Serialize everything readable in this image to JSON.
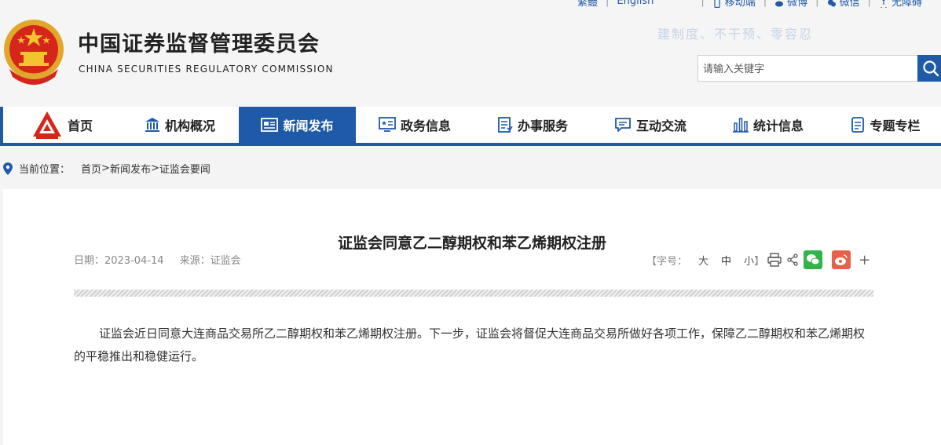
{
  "top_links": {
    "simplified": "繁體",
    "english": "English",
    "mobile": "移动端",
    "weibo": "微博",
    "wechat": "微信",
    "accessible": "无障碍"
  },
  "site": {
    "title": "中国证券监督管理委员会",
    "subtitle": "CHINA SECURITIES REGULATORY COMMISSION",
    "slogan": "建制度、不干预、零容忍"
  },
  "search": {
    "placeholder": "请输入关键字"
  },
  "nav": {
    "items": [
      {
        "label": "首页",
        "icon": "csrc-logo-icon"
      },
      {
        "label": "机构概况",
        "icon": "institution-icon"
      },
      {
        "label": "新闻发布",
        "icon": "news-icon"
      },
      {
        "label": "政务信息",
        "icon": "gov-info-icon"
      },
      {
        "label": "办事服务",
        "icon": "service-icon"
      },
      {
        "label": "互动交流",
        "icon": "chat-icon"
      },
      {
        "label": "统计信息",
        "icon": "stats-icon"
      },
      {
        "label": "专题专栏",
        "icon": "topic-icon"
      }
    ],
    "active_index": 2
  },
  "breadcrumb": {
    "label": "当前位置：",
    "path": [
      "首页",
      "新闻发布",
      "证监会要闻"
    ],
    "separator": ">"
  },
  "article": {
    "title": "证监会同意乙二醇期权和苯乙烯期权注册",
    "date": "日期：2023-04-14",
    "source": "来源：证监会",
    "font_size_label": "【字号：",
    "font_large": "大",
    "font_medium": "中",
    "font_small": "小",
    "font_close": "】",
    "body": "证监会近日同意大连商品交易所乙二醇期权和苯乙烯期权注册。下一步，证监会将督促大连商品交易所做好各项工作，保障乙二醇期权和苯乙烯期权的平稳推出和稳健运行。"
  },
  "colors": {
    "brand_blue": "#1e5aa8",
    "wechat_green": "#33b34a",
    "weibo_red": "#e6624a"
  }
}
